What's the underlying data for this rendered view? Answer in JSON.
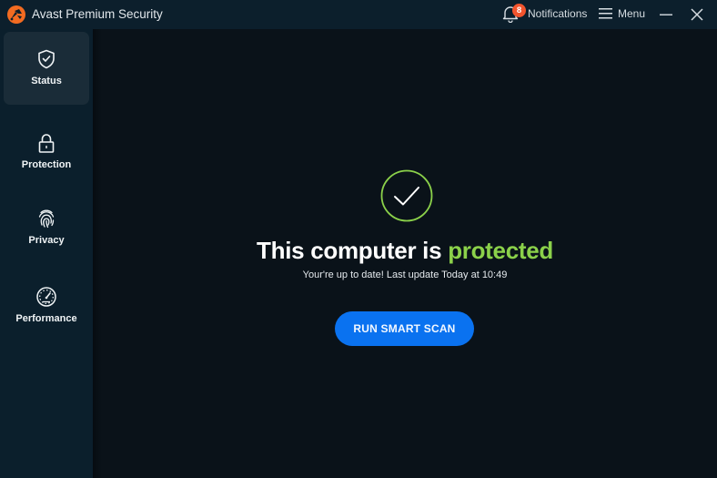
{
  "titlebar": {
    "app_title": "Avast Premium Security",
    "notifications": {
      "label": "Notifications",
      "count": "8",
      "icon": "bell-icon"
    },
    "menu": {
      "label": "Menu",
      "icon": "hamburger-icon"
    },
    "minimize_icon": "minimize-icon",
    "close_icon": "close-icon"
  },
  "sidebar": {
    "items": [
      {
        "label": "Status",
        "icon": "shield-check-icon",
        "active": true
      },
      {
        "label": "Protection",
        "icon": "lock-icon",
        "active": false
      },
      {
        "label": "Privacy",
        "icon": "fingerprint-icon",
        "active": false
      },
      {
        "label": "Performance",
        "icon": "speedometer-icon",
        "active": false
      }
    ]
  },
  "main": {
    "status_icon": "check-circle-icon",
    "headline_prefix": "This computer is ",
    "headline_status": "protected",
    "subtitle": "Your're up to date! Last update Today at 10:49",
    "scan_button": "RUN SMART SCAN"
  },
  "colors": {
    "brand_orange": "#f26b21",
    "status_green": "#8bd14a",
    "button_blue": "#0a72f0",
    "badge_red": "#f2542d",
    "sidebar_bg": "#0b1f2c",
    "main_bg": "#0a1219"
  }
}
